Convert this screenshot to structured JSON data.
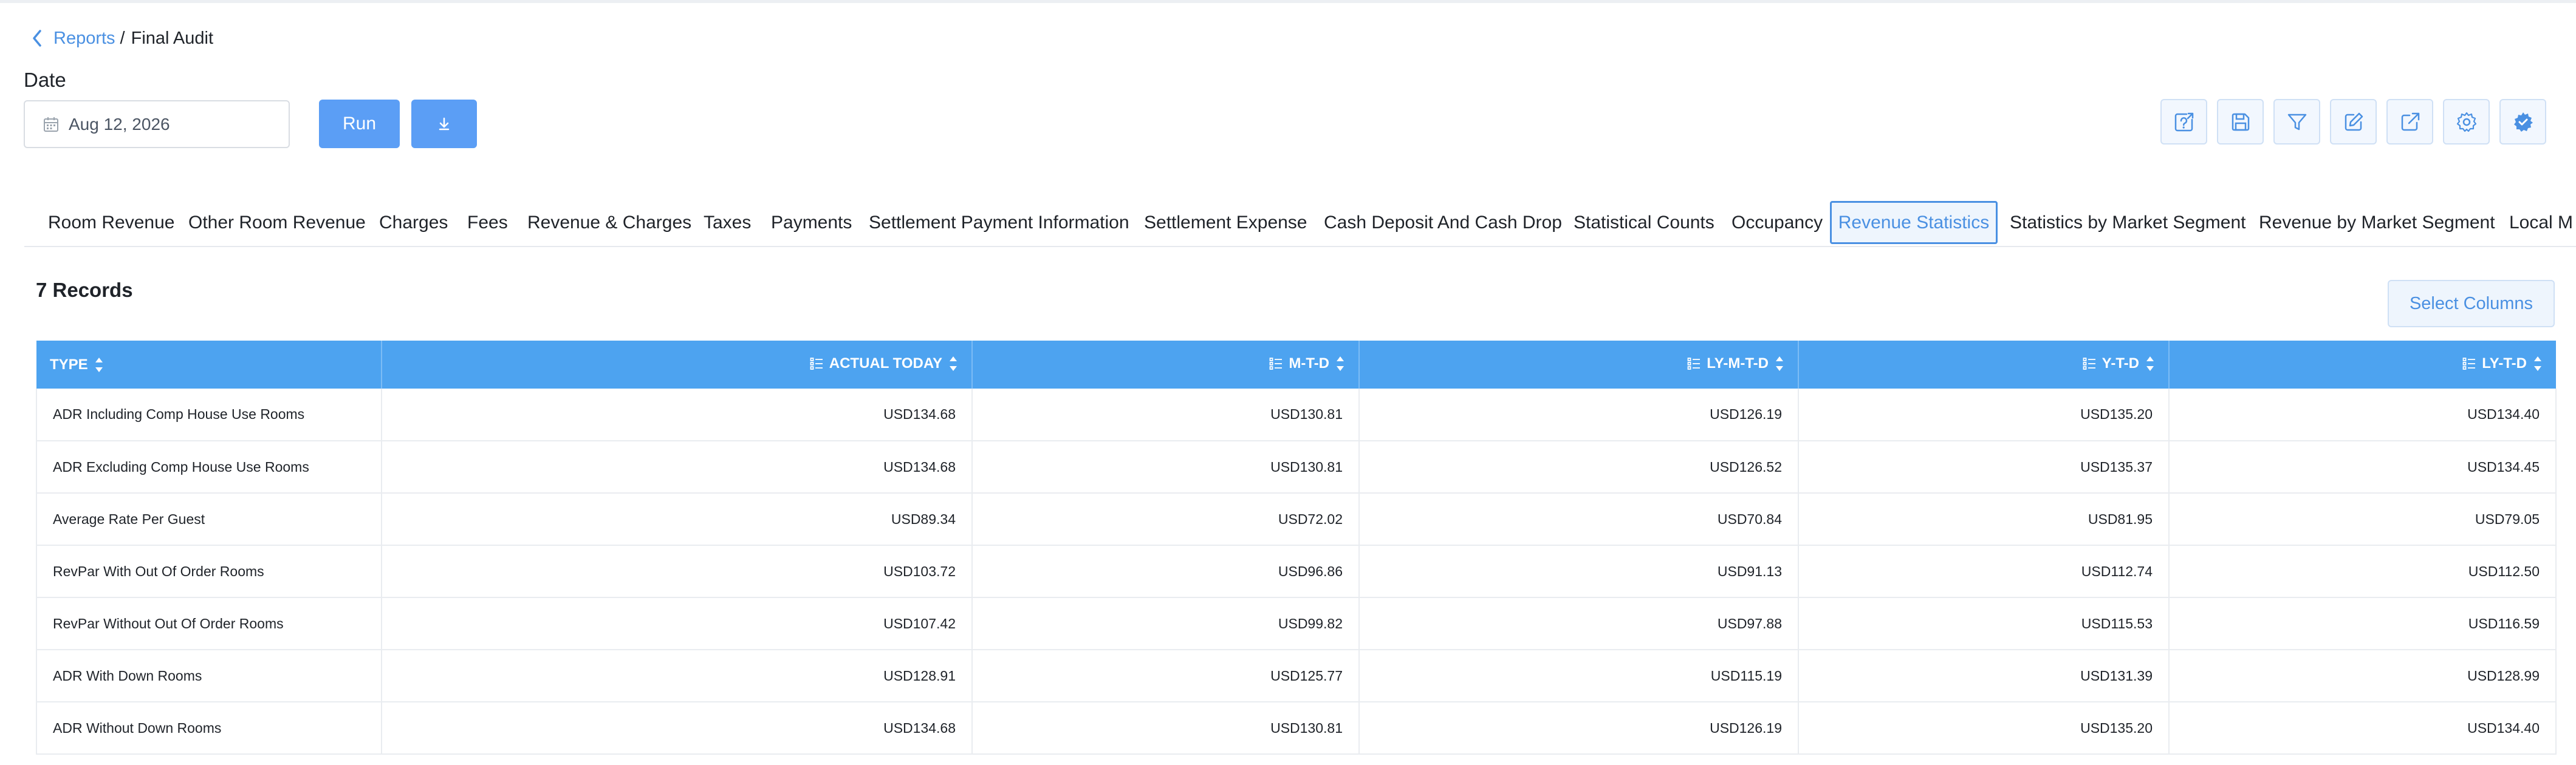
{
  "breadcrumb": {
    "parent": "Reports",
    "separator": "/",
    "current": "Final Audit"
  },
  "filters": {
    "date_label": "Date",
    "date_value": "Aug 12, 2026"
  },
  "actions": {
    "run_label": "Run"
  },
  "toolbar": {
    "icons": [
      "help-report-icon",
      "save-icon",
      "filter-icon",
      "edit-icon",
      "external-link-icon",
      "settings-icon",
      "gear-check-icon"
    ]
  },
  "tabs": [
    "Room Revenue",
    "Other Room Revenue",
    "Charges",
    "Fees",
    "Revenue & Charges",
    "Taxes",
    "Payments",
    "Settlement Payment Information",
    "Settlement Expense",
    "Cash Deposit And Cash Drop",
    "Statistical Counts",
    "Occupancy",
    "Revenue Statistics",
    "Statistics by Market Segment",
    "Revenue by Market Segment",
    "Local M"
  ],
  "active_tab": "Revenue Statistics",
  "records_label": "7 Records",
  "select_columns_label": "Select Columns",
  "table": {
    "columns": [
      "TYPE",
      "ACTUAL TODAY",
      "M-T-D",
      "LY-M-T-D",
      "Y-T-D",
      "LY-T-D"
    ],
    "rows": [
      [
        "ADR Including Comp House Use Rooms",
        "USD134.68",
        "USD130.81",
        "USD126.19",
        "USD135.20",
        "USD134.40"
      ],
      [
        "ADR Excluding Comp House Use Rooms",
        "USD134.68",
        "USD130.81",
        "USD126.52",
        "USD135.37",
        "USD134.45"
      ],
      [
        "Average Rate Per Guest",
        "USD89.34",
        "USD72.02",
        "USD70.84",
        "USD81.95",
        "USD79.05"
      ],
      [
        "RevPar With Out Of Order Rooms",
        "USD103.72",
        "USD96.86",
        "USD91.13",
        "USD112.74",
        "USD112.50"
      ],
      [
        "RevPar Without Out Of Order Rooms",
        "USD107.42",
        "USD99.82",
        "USD97.88",
        "USD115.53",
        "USD116.59"
      ],
      [
        "ADR With Down Rooms",
        "USD128.91",
        "USD125.77",
        "USD115.19",
        "USD131.39",
        "USD128.99"
      ],
      [
        "ADR Without Down Rooms",
        "USD134.68",
        "USD130.81",
        "USD126.19",
        "USD135.20",
        "USD134.40"
      ]
    ]
  },
  "colors": {
    "accent": "#4a90e2",
    "header_bg": "#4da3f0",
    "button_bg": "#5b9ef5"
  }
}
